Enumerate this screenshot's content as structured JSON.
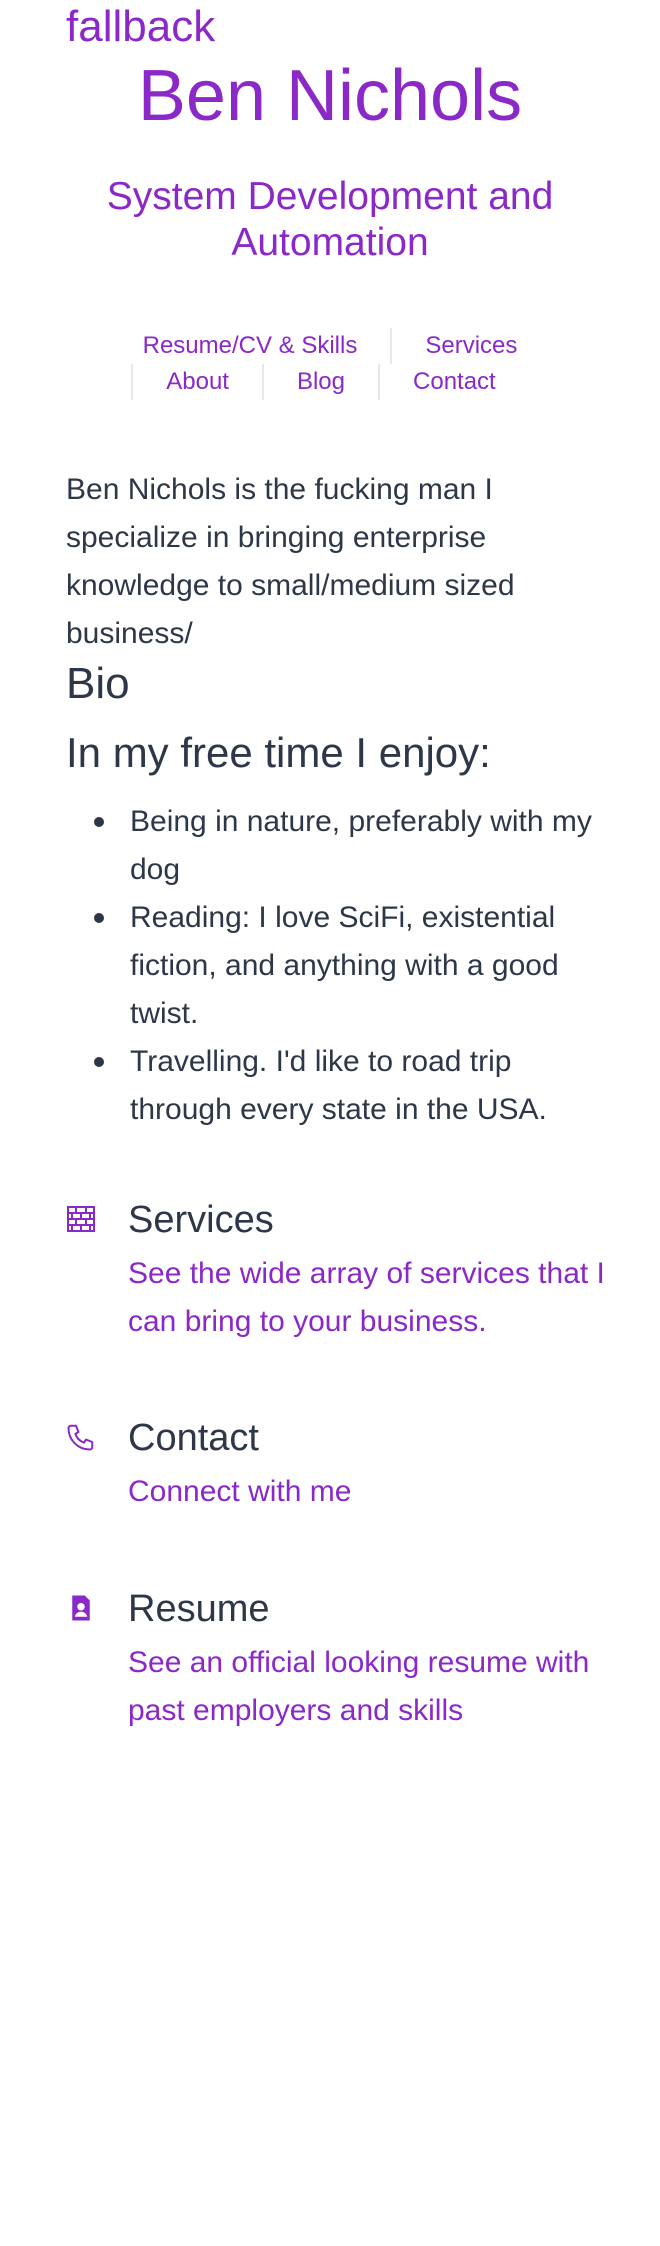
{
  "fallback_text": "fallback",
  "site": {
    "title": "Ben Nichols",
    "tagline": "System Development and Automation"
  },
  "nav": {
    "resume": "Resume/CV & Skills",
    "services": "Services",
    "about": "About",
    "blog": "Blog",
    "contact": "Contact"
  },
  "intro": "Ben Nichols is the fucking man I specialize in bringing enterprise knowledge to small/medium sized business/",
  "bio_heading": "Bio",
  "free_time": {
    "heading": "In my free time I enjoy:",
    "items": [
      "Being in nature, preferably with my dog",
      "Reading: I love SciFi, existential fiction, and anything with a good twist.",
      "Travelling. I'd like to road trip through every state in the USA."
    ]
  },
  "features": [
    {
      "icon": "brick-wall-icon",
      "title": "Services",
      "description": "See the wide array of services that I can bring to your business."
    },
    {
      "icon": "phone-icon",
      "title": "Contact",
      "description": "Connect with me"
    },
    {
      "icon": "resume-profile-icon",
      "title": "Resume",
      "description": "See an official looking resume with past employers and skills"
    }
  ],
  "colors": {
    "accent": "#8b28c8",
    "text": "#2d3748",
    "separator": "#e2e8f0",
    "background": "#ffffff"
  }
}
